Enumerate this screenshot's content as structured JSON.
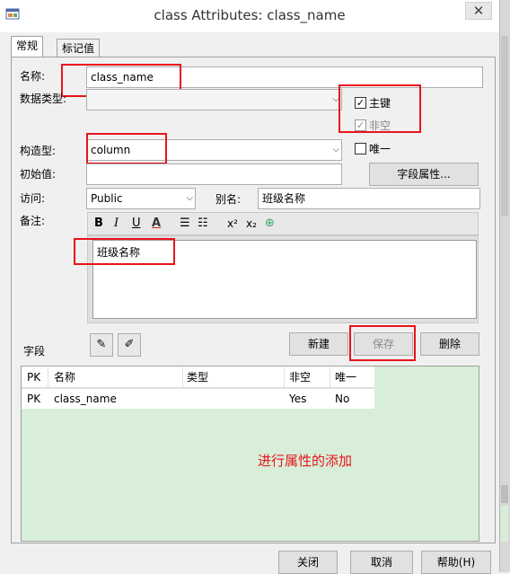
{
  "window": {
    "title": "class Attributes: class_name",
    "close_glyph": "✕"
  },
  "tabs": [
    {
      "label": "常规"
    },
    {
      "label": "标记值"
    }
  ],
  "form": {
    "name_label": "名称:",
    "name_value": "class_name",
    "datatype_label": "数据类型:",
    "datatype_value": "",
    "primary_key_label": "主键",
    "primary_key_checked": true,
    "not_null_label": "非空",
    "not_null_checked": true,
    "stereotype_label": "构造型:",
    "stereotype_value": "column",
    "unique_label": "唯一",
    "unique_checked": false,
    "initial_label": "初始值:",
    "initial_value": "",
    "field_props_button": "字段属性...",
    "access_label": "访问:",
    "access_value": "Public",
    "alias_label": "别名:",
    "alias_value": "班级名称",
    "notes_label": "备注:",
    "notes_value": "班级名称"
  },
  "richtext_toolbar": {
    "bold": "B",
    "italic": "I",
    "underline": "U",
    "font_color": "A",
    "bullets": "☰",
    "numbering": "☷",
    "superscript": "x²",
    "subscript": "x₂",
    "hyperlink": "⊕"
  },
  "fields": {
    "label": "字段",
    "new_button": "新建",
    "save_button": "保存",
    "delete_button": "删除",
    "columns": [
      "PK",
      "名称",
      "类型",
      "非空",
      "唯一"
    ],
    "rows": [
      {
        "pk": "PK",
        "name": "class_name",
        "type": "",
        "not_null": "Yes",
        "unique": "No"
      }
    ],
    "annotation": "进行属性的添加"
  },
  "footer": {
    "close_button": "关闭",
    "cancel_button": "取消",
    "help_button": "帮助(H)"
  },
  "colors": {
    "highlight_box": "#e8141b",
    "annotation_text": "#e8141b",
    "grid_background": "#d8eed8"
  }
}
